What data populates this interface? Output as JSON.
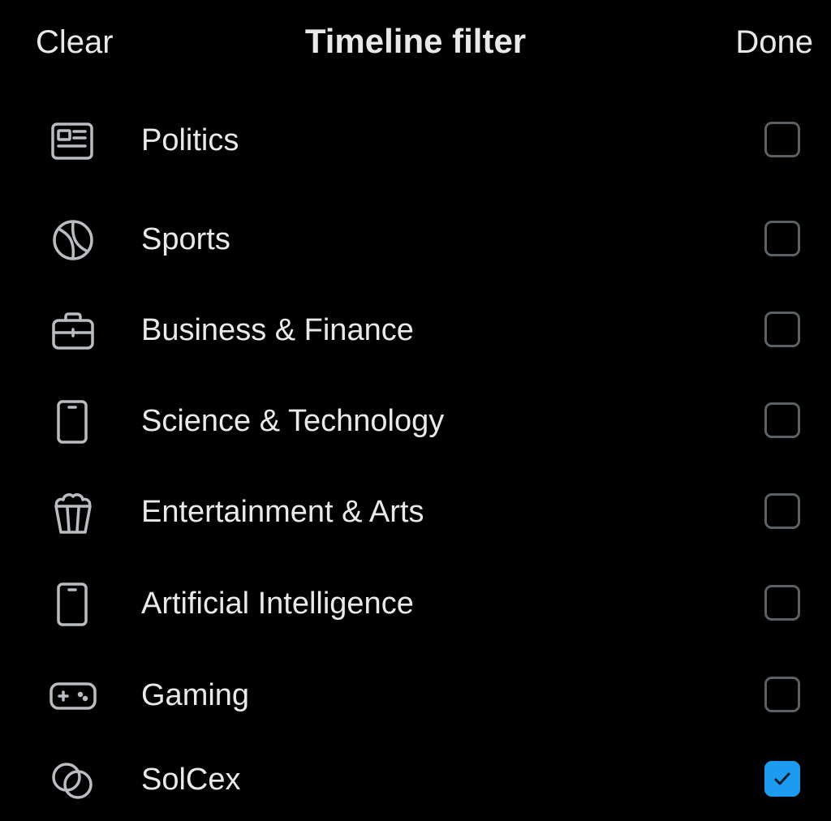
{
  "header": {
    "clear_label": "Clear",
    "title": "Timeline filter",
    "done_label": "Done"
  },
  "filters": [
    {
      "label": "Politics",
      "icon": "newspaper-icon",
      "checked": false
    },
    {
      "label": "Sports",
      "icon": "tennis-ball-icon",
      "checked": false
    },
    {
      "label": "Business & Finance",
      "icon": "briefcase-icon",
      "checked": false
    },
    {
      "label": "Science & Technology",
      "icon": "phone-icon",
      "checked": false
    },
    {
      "label": "Entertainment & Arts",
      "icon": "popcorn-icon",
      "checked": false
    },
    {
      "label": "Artificial Intelligence",
      "icon": "phone-icon",
      "checked": false
    },
    {
      "label": "Gaming",
      "icon": "gamepad-icon",
      "checked": false
    },
    {
      "label": "SolCex",
      "icon": "overlapping-circles-icon",
      "checked": true
    }
  ],
  "colors": {
    "background": "#000000",
    "text": "#e7e9ea",
    "icon": "#b9bdc1",
    "checkbox_border": "#5b6065",
    "accent": "#1d9bf0"
  }
}
